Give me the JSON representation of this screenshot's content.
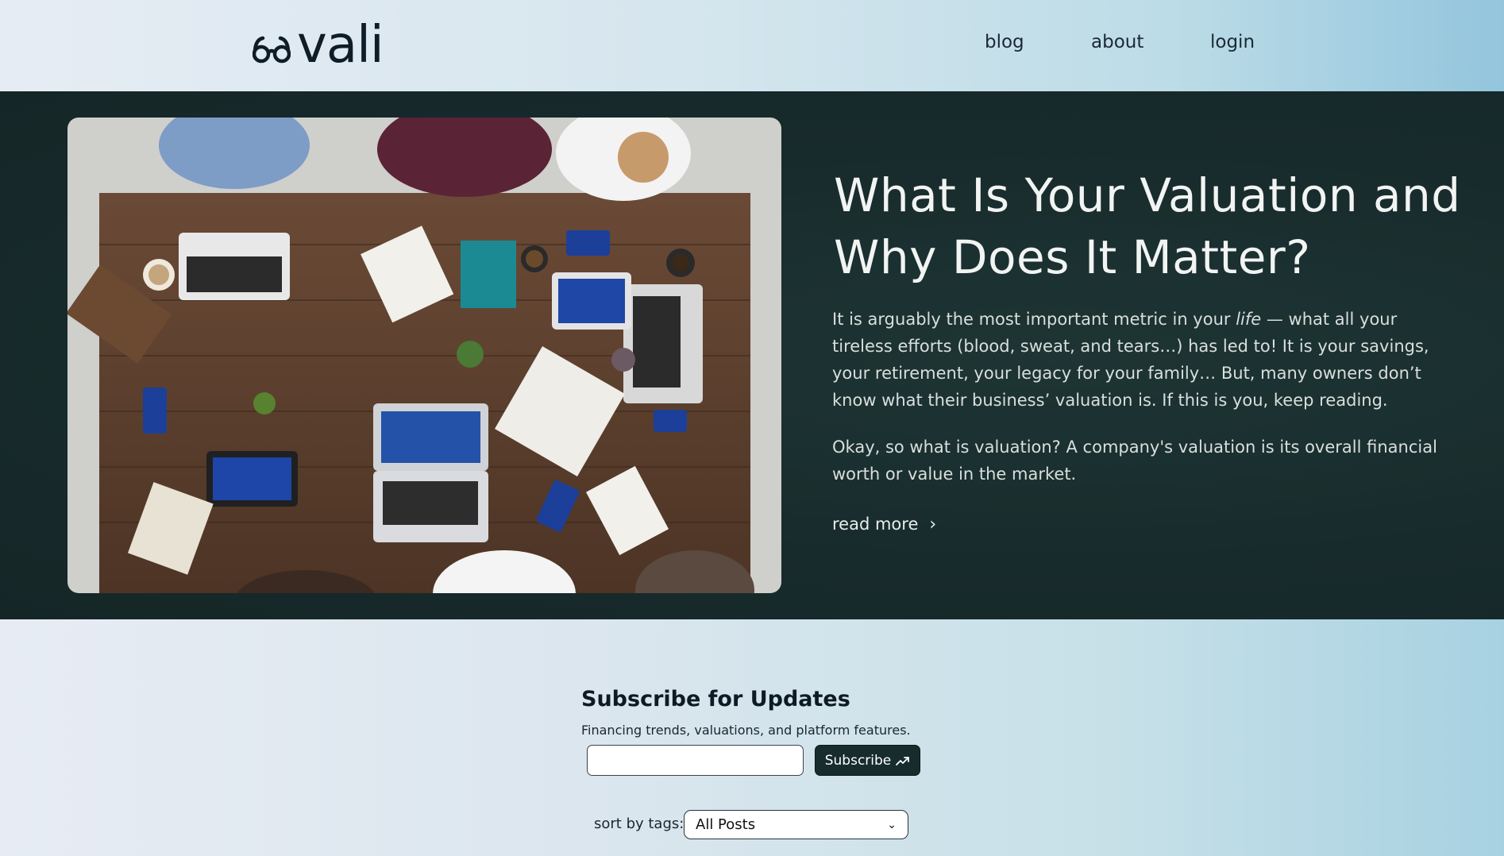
{
  "brand": {
    "name": "vali",
    "logo_icon": "glasses-icon"
  },
  "nav": {
    "items": [
      "blog",
      "about",
      "login"
    ]
  },
  "hero": {
    "title": "What Is Your Valuation and Why Does It Matter?",
    "p1_before": "It is arguably the most important metric in your ",
    "p1_em": "life",
    "p1_after": " — what all your tireless efforts (blood, sweat, and tears…) has led to! It is your savings, your retirement, your legacy for your family… But, many owners don’t know what their business’ valuation is. If this is you, keep reading.",
    "p2": "Okay, so what is valuation? A company's valuation is its overall financial worth or value in the market.",
    "read_more": "read more",
    "read_more_icon": "chevron-right-icon",
    "image_alt": "team working at wooden table with laptops, tablets and phones"
  },
  "subscribe": {
    "title": "Subscribe for Updates",
    "description": "Financing trends, valuations, and platform features.",
    "email_value": "",
    "button_label": "Subscribe",
    "button_icon": "trending-up-icon"
  },
  "sort": {
    "label": "sort by tags:",
    "selected": "All Posts"
  },
  "colors": {
    "hero_bg": "#172b2c",
    "button_bg": "#172c2d",
    "header_gradient_end": "#93c5dd"
  }
}
